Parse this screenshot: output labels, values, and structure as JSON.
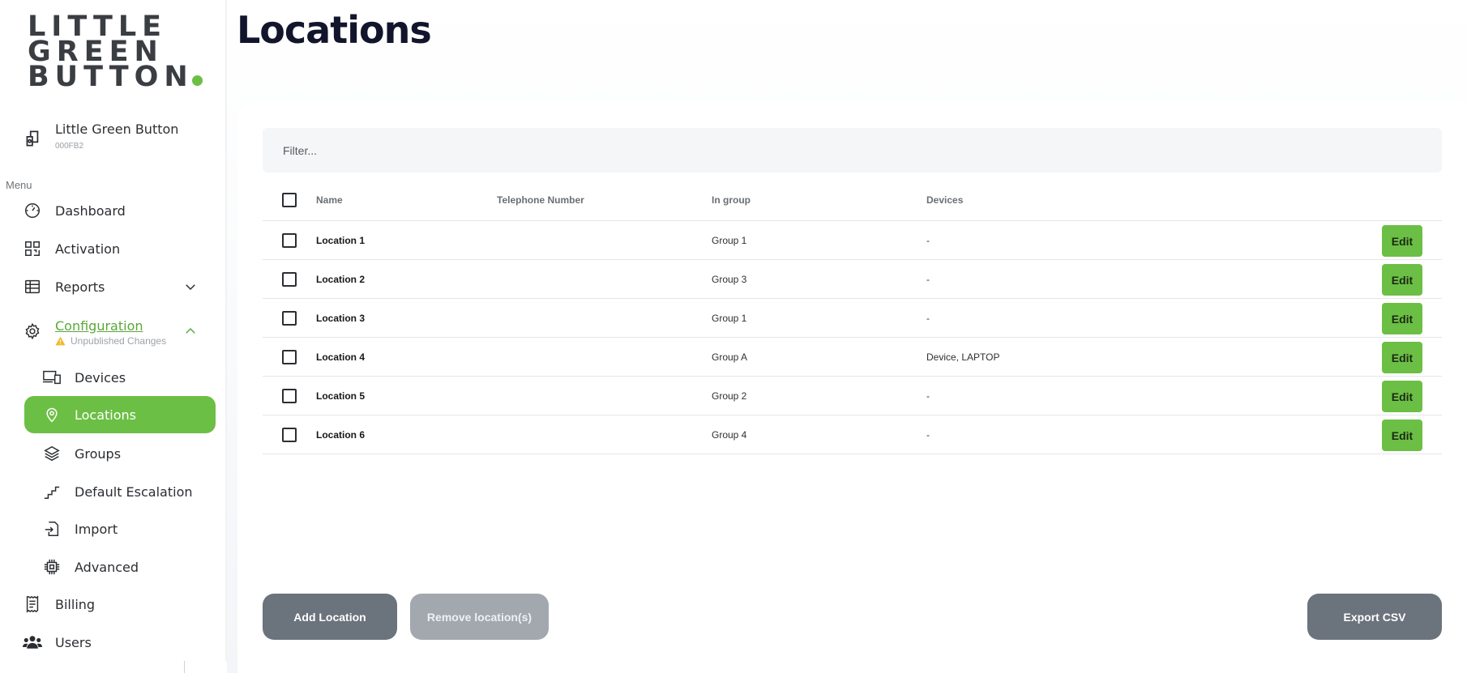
{
  "brand": {
    "logo_lines": [
      "LITTLE",
      "GREEN",
      "BUTTON"
    ],
    "accent_color": "#6cbf45"
  },
  "account": {
    "name": "Little Green Button",
    "code": "000FB2"
  },
  "sidebar": {
    "menu_label": "Menu",
    "items": {
      "dashboard": "Dashboard",
      "activation": "Activation",
      "reports": "Reports",
      "configuration": "Configuration",
      "unpublished": "Unpublished Changes",
      "devices": "Devices",
      "locations": "Locations",
      "groups": "Groups",
      "default_escalation": "Default Escalation",
      "import": "Import",
      "advanced": "Advanced",
      "billing": "Billing",
      "users": "Users"
    }
  },
  "page": {
    "title": "Locations"
  },
  "filter": {
    "placeholder": "Filter..."
  },
  "table": {
    "headers": {
      "name": "Name",
      "telephone": "Telephone Number",
      "group": "In group",
      "devices": "Devices"
    },
    "edit_label": "Edit",
    "rows": [
      {
        "name": "Location 1",
        "telephone": "",
        "group": "Group 1",
        "devices": "-"
      },
      {
        "name": "Location 2",
        "telephone": "",
        "group": "Group 3",
        "devices": "-"
      },
      {
        "name": "Location 3",
        "telephone": "",
        "group": "Group 1",
        "devices": "-"
      },
      {
        "name": "Location 4",
        "telephone": "",
        "group": "Group A",
        "devices": "Device, LAPTOP"
      },
      {
        "name": "Location 5",
        "telephone": "",
        "group": "Group 2",
        "devices": "-"
      },
      {
        "name": "Location 6",
        "telephone": "",
        "group": "Group 4",
        "devices": "-"
      }
    ]
  },
  "actions": {
    "add": "Add Location",
    "remove": "Remove location(s)",
    "export": "Export CSV"
  }
}
